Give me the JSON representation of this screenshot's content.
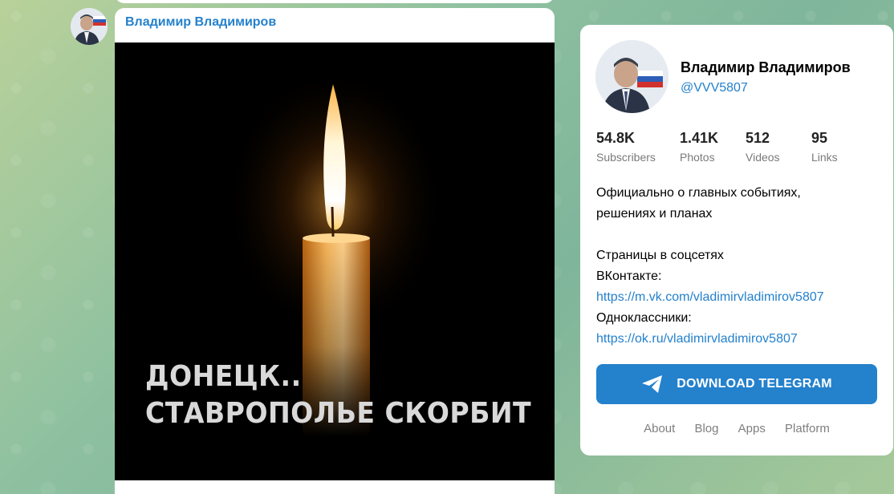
{
  "channel": {
    "name": "Владимир Владимиров",
    "handle": "@VVV5807"
  },
  "post": {
    "author": "Владимир Владимиров",
    "image_caption_line1": "ДОНЕЦК..",
    "image_caption_line2": "СТАВРОПОЛЬЕ СКОРБИТ"
  },
  "stats": [
    {
      "value": "54.8K",
      "label": "Subscribers"
    },
    {
      "value": "1.41K",
      "label": "Photos"
    },
    {
      "value": "512",
      "label": "Videos"
    },
    {
      "value": "95",
      "label": "Links"
    }
  ],
  "description": {
    "line1": "Официально о главных событиях,",
    "line2": "решениях и планах",
    "line3": "Страницы в соцсетях",
    "line4": "ВКонтакте:",
    "link1": "https://m.vk.com/vladimirvladimirov5807",
    "line5": "Одноклассники:",
    "link2": "https://ok.ru/vladimirvladimirov5807"
  },
  "download_button": "DOWNLOAD TELEGRAM",
  "footer": {
    "about": "About",
    "blog": "Blog",
    "apps": "Apps",
    "platform": "Platform"
  },
  "colors": {
    "accent": "#2481cc",
    "card_bg": "#ffffff",
    "photo_bg": "#000000"
  }
}
